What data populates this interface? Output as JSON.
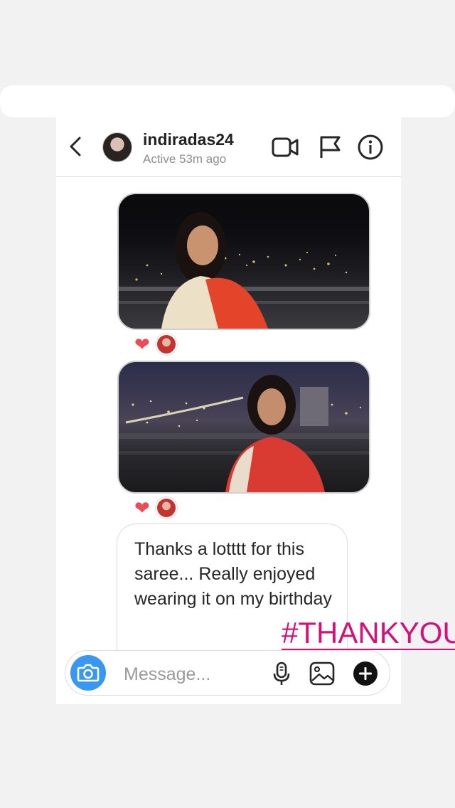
{
  "header": {
    "username": "indiradas24",
    "status": "Active 53m ago",
    "icons": [
      "back-chevron-icon",
      "video-call-icon",
      "flag-icon",
      "info-icon"
    ]
  },
  "messages": {
    "photos": [
      {
        "reaction": "heart"
      },
      {
        "reaction": "heart"
      }
    ],
    "text": "Thanks a lotttt for this saree... Really enjoyed wearing it on my birthday"
  },
  "composer": {
    "placeholder": "Message...",
    "icons": [
      "camera-icon",
      "microphone-icon",
      "gallery-icon",
      "plus-icon"
    ]
  },
  "overlay": {
    "hashtag": "#THANKYOU"
  },
  "colors": {
    "accent_blue": "#3897f0",
    "heart_red": "#ed4956",
    "hashtag_pink": "#d4117a"
  }
}
